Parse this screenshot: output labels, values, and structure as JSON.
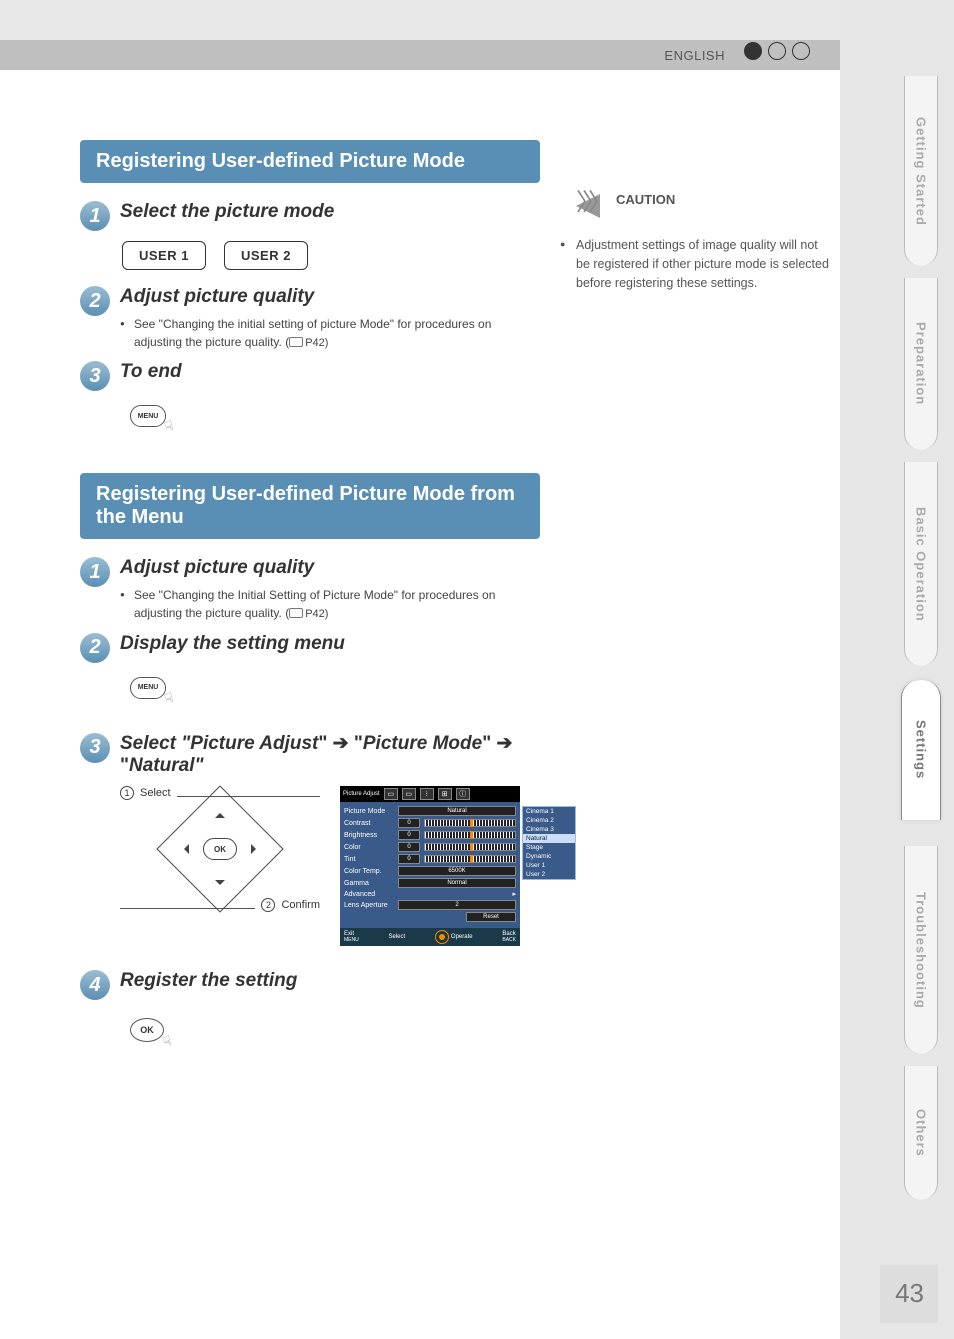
{
  "header": {
    "language": "ENGLISH"
  },
  "caution": {
    "title": "CAUTION",
    "text": "Adjustment settings of image quality will not be registered if other picture mode is selected before registering these settings."
  },
  "section1": {
    "title": "Registering User-defined Picture Mode",
    "step1_title": "Select the picture mode",
    "user1": "USER 1",
    "user2": "USER 2",
    "step2_title": "Adjust picture quality",
    "step2_bullet": "See \"Changing the initial setting of picture Mode\" for procedures on adjusting the picture quality. (",
    "step2_ref": "P42)",
    "step3_title": "To end",
    "menu_label": "MENU"
  },
  "section2": {
    "title": "Registering User-defined Picture Mode from the Menu",
    "step1_title": "Adjust picture quality",
    "step1_bullet": "See \"Changing the Initial Setting of Picture Mode\" for procedures on adjusting the picture quality. (",
    "step1_ref": "P42)",
    "step2_title": "Display the setting menu",
    "menu_label": "MENU",
    "step3_title_a": "Select \"",
    "step3_title_b": "Picture Adjust",
    "step3_title_c": "\" ➔ \"",
    "step3_title_d": "Picture Mode",
    "step3_title_e": "\" ➔ \"",
    "step3_title_f": "Natural",
    "step3_title_g": "\"",
    "fig_select": "Select",
    "fig_confirm": "Confirm",
    "fig_ok": "OK",
    "step4_title": "Register the setting",
    "ok_label": "OK"
  },
  "osd": {
    "tab_label": "Picture Adjust",
    "rows": {
      "picture_mode": "Picture Mode",
      "picture_mode_val": "Natural",
      "contrast": "Contrast",
      "contrast_val": "0",
      "brightness": "Brightness",
      "brightness_val": "0",
      "color": "Color",
      "color_val": "0",
      "tint": "Tint",
      "tint_val": "0",
      "color_temp": "Color Temp.",
      "color_temp_val": "6500K",
      "gamma": "Gamma",
      "gamma_val": "Normal",
      "advanced": "Advanced",
      "lens_aperture": "Lens Aperture",
      "lens_aperture_val": "2",
      "reset": "Reset"
    },
    "popup": [
      "Cinema 1",
      "Cinema 2",
      "Cinema 3",
      "Natural",
      "Stage",
      "Dynamic",
      "User 1",
      "User 2"
    ],
    "popup_selected": "Natural",
    "foot": {
      "exit": "Exit",
      "exit_sub": "MENU",
      "select": "Select",
      "operate": "Operate",
      "back": "Back",
      "back_sub": "BACK"
    }
  },
  "tabs": {
    "t1": "Getting Started",
    "t2": "Preparation",
    "t3": "Basic Operation",
    "t4": "Settings",
    "t5": "Troubleshooting",
    "t6": "Others"
  },
  "page_number": "43"
}
